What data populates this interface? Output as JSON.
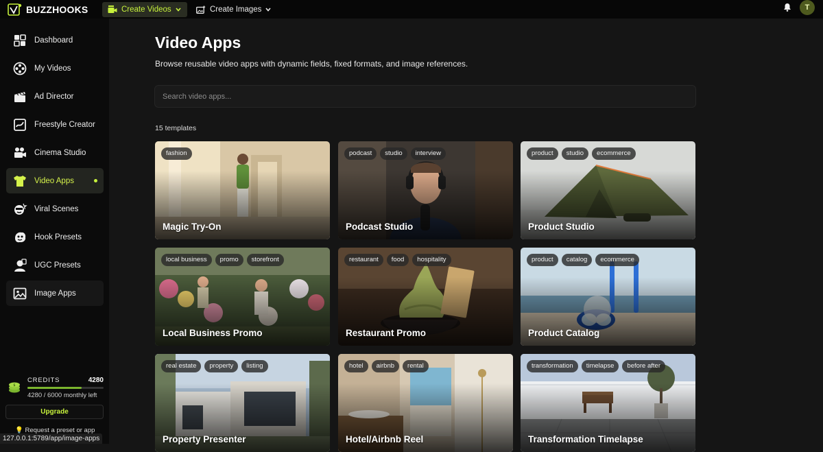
{
  "brand": {
    "name": "BUZZHOOKS"
  },
  "topnav": {
    "create_videos": "Create Videos",
    "create_images": "Create Images",
    "avatar_initial": "T"
  },
  "sidebar": {
    "items": [
      {
        "label": "Dashboard",
        "icon": "dashboard-icon"
      },
      {
        "label": "My Videos",
        "icon": "film-reel-icon"
      },
      {
        "label": "Ad Director",
        "icon": "clapperboard-icon"
      },
      {
        "label": "Freestyle Creator",
        "icon": "freestyle-icon"
      },
      {
        "label": "Cinema Studio",
        "icon": "cinema-camera-icon"
      },
      {
        "label": "Video Apps",
        "icon": "shirt-icon",
        "active": true
      },
      {
        "label": "Viral Scenes",
        "icon": "viral-scenes-icon"
      },
      {
        "label": "Hook Presets",
        "icon": "hook-presets-icon"
      },
      {
        "label": "UGC Presets",
        "icon": "ugc-presets-icon"
      },
      {
        "label": "Image Apps",
        "icon": "image-icon"
      }
    ],
    "credits": {
      "label": "CREDITS",
      "value": "4280",
      "subtext": "4280 / 6000 monthly left",
      "fraction": 0.713
    },
    "upgrade_label": "Upgrade",
    "request_text": "💡 Request a preset or app"
  },
  "status_url": "127.0.0.1:5789/app/image-apps",
  "main": {
    "title": "Video Apps",
    "subtitle": "Browse reusable video apps with dynamic fields, fixed formats, and image references.",
    "search_placeholder": "Search video apps...",
    "count_text": "15 templates",
    "cards": [
      {
        "title": "Magic Try-On",
        "tags": [
          "fashion"
        ]
      },
      {
        "title": "Podcast Studio",
        "tags": [
          "podcast",
          "studio",
          "interview"
        ]
      },
      {
        "title": "Product Studio",
        "tags": [
          "product",
          "studio",
          "ecommerce"
        ]
      },
      {
        "title": "Local Business Promo",
        "tags": [
          "local business",
          "promo",
          "storefront"
        ]
      },
      {
        "title": "Restaurant Promo",
        "tags": [
          "restaurant",
          "food",
          "hospitality"
        ]
      },
      {
        "title": "Product Catalog",
        "tags": [
          "product",
          "catalog",
          "ecommerce"
        ]
      },
      {
        "title": "Property Presenter",
        "tags": [
          "real estate",
          "property",
          "listing"
        ]
      },
      {
        "title": "Hotel/Airbnb Reel",
        "tags": [
          "hotel",
          "airbnb",
          "rental"
        ]
      },
      {
        "title": "Transformation Timelapse",
        "tags": [
          "transformation",
          "timelapse",
          "before after"
        ]
      }
    ]
  },
  "colors": {
    "accent": "#c7f23c",
    "background": "#151515",
    "sidebar": "#0b0b0b"
  }
}
